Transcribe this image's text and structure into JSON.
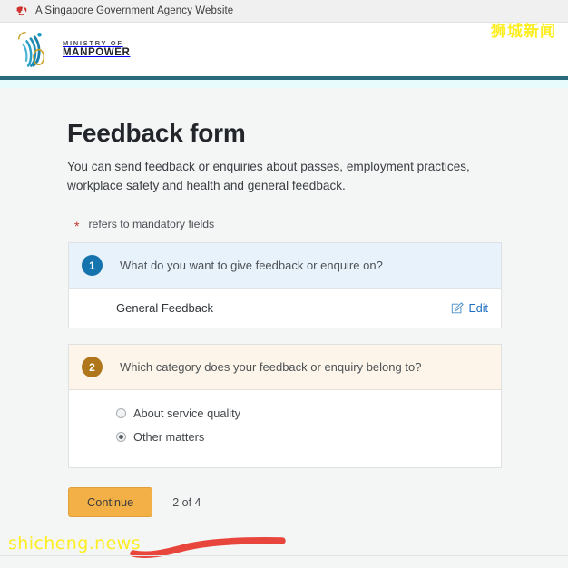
{
  "gov_banner": {
    "icon": "singapore-lion-icon",
    "text": "A Singapore Government Agency Website"
  },
  "masthead": {
    "logo_icon": "ministry-of-manpower-logo",
    "logo_line1": "MINISTRY OF",
    "logo_line2": "MANPOWER",
    "rule_color": "#2a6a7d",
    "band_color": "#e8fbfc"
  },
  "main": {
    "title": "Feedback form",
    "intro": "You can send feedback or enquiries about passes, employment practices, workplace safety and health and general feedback.",
    "mandatory_note": {
      "asterisk": "*",
      "text": "refers to mandatory fields"
    },
    "sections": [
      {
        "number": "1",
        "badge_color": "#1573ae",
        "question": "What do you want to give feedback or enquire on?",
        "answer": "General Feedback",
        "edit_icon": "pencil-edit-icon",
        "edit_label": "Edit"
      },
      {
        "number": "2",
        "badge_color": "#b0761b",
        "question": "Which category does your feedback or enquiry belong to?",
        "options": [
          {
            "label": "About service quality",
            "selected": false
          },
          {
            "label": "Other matters",
            "selected": true
          }
        ]
      }
    ],
    "actions": {
      "continue_label": "Continue",
      "continue_color": "#f2b046",
      "step_counter": "2 of 4"
    }
  },
  "annotation": {
    "name": "red-highlight-stroke",
    "color": "#e8453c"
  },
  "watermarks": {
    "top_right": "狮城新闻",
    "bottom_left": "shicheng.news",
    "color": "#fcee21"
  }
}
